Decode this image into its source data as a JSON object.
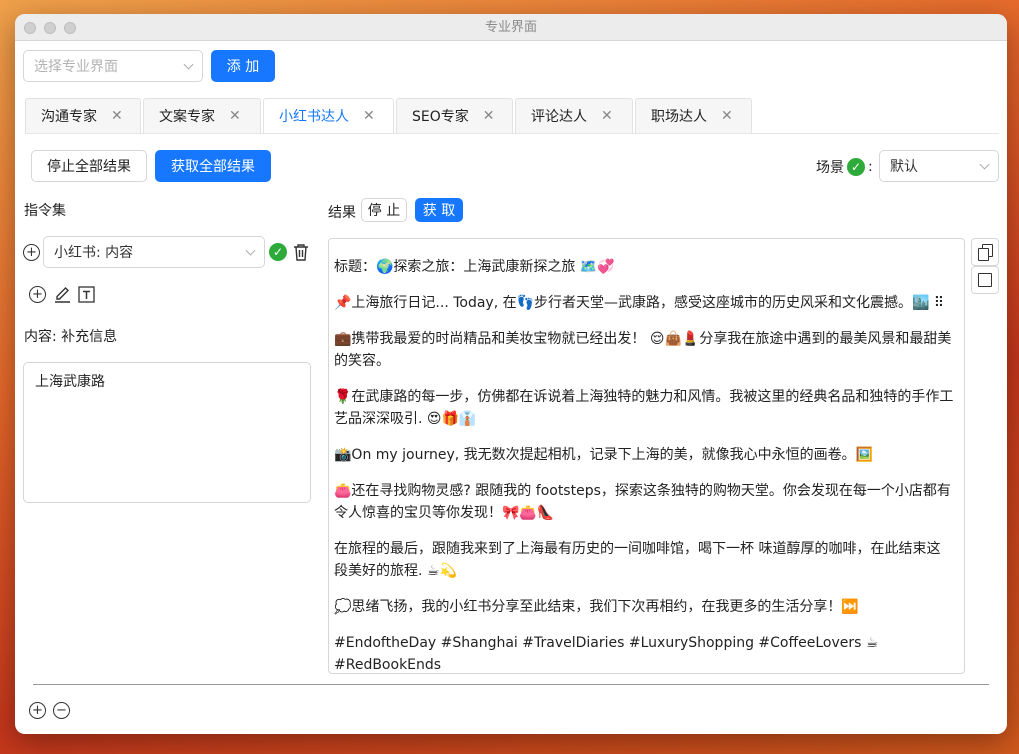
{
  "window": {
    "title": "专业界面"
  },
  "toolbar": {
    "select_placeholder": "选择专业界面",
    "add_label": "添 加"
  },
  "tabs": [
    {
      "label": "沟通专家",
      "active": false
    },
    {
      "label": "文案专家",
      "active": false
    },
    {
      "label": "小红书达人",
      "active": true
    },
    {
      "label": "SEO专家",
      "active": false
    },
    {
      "label": "评论达人",
      "active": false
    },
    {
      "label": "职场达人",
      "active": false
    }
  ],
  "actions": {
    "stop_all": "停止全部结果",
    "get_all": "获取全部结果"
  },
  "scene": {
    "label": "场景",
    "colon": ":",
    "value": "默认"
  },
  "instructions": {
    "heading": "指令集",
    "selected": "小红书: 内容",
    "content_label": "内容: 补充信息",
    "content_value": "上海武康路"
  },
  "result": {
    "heading": "结果",
    "stop_label": "停 止",
    "get_label": "获 取",
    "paragraphs": [
      "标题：🌍探索之旅：上海武康新探之旅 🗺️💞",
      "📌上海旅行日记... Today, 在👣步行者天堂—武康路，感受这座城市的历史风采和文化震撼。🏙️ ⠿",
      "💼携带我最爱的时尚精品和美妆宝物就已经出发！ 😌👜💄分享我在旅途中遇到的最美风景和最甜美的笑容。",
      "🌹在武康路的每一步，仿佛都在诉说着上海独特的魅力和风情。我被这里的经典名品和独特的手作工艺品深深吸引. 😍🎁👔",
      "📸On my journey, 我无数次提起相机，记录下上海的美，就像我心中永恒的画卷。🖼️",
      "👛还在寻找购物灵感? 跟随我的 footsteps，探索这条独特的购物天堂。你会发现在每一个小店都有令人惊喜的宝贝等你发现！🎀👛👠",
      "在旅程的最后，跟随我来到了上海最有历史的一间咖啡馆，喝下一杯 味道醇厚的咖啡，在此结束这段美好的旅程. ☕💫",
      "💭思绪飞扬，我的小红书分享至此结束，我们下次再相约，在我更多的生活分享！⏭️",
      "#EndoftheDay #Shanghai #TravelDiaries #LuxuryShopping #CoffeeLovers ☕ #RedBookEnds"
    ]
  },
  "colors": {
    "accent": "#1778ff",
    "success": "#2eaa3a"
  }
}
